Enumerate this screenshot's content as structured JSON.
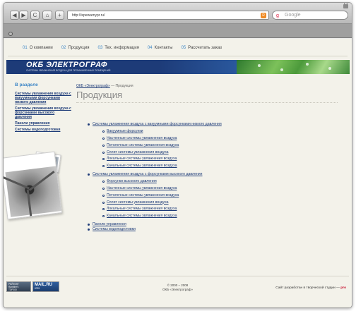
{
  "browser": {
    "url": "http://ixpewarnypr.ru/",
    "search_placeholder": "Google",
    "rss_label": "R",
    "search_glyph": "g",
    "buttons": {
      "back": "◀",
      "forward": "▶",
      "reload": "C",
      "home": "⌂",
      "add": "+"
    }
  },
  "topnav": [
    {
      "num": "01",
      "label": "О компании"
    },
    {
      "num": "02",
      "label": "Продукция"
    },
    {
      "num": "03",
      "label": "Тех. информация"
    },
    {
      "num": "04",
      "label": "Контакты"
    },
    {
      "num": "05",
      "label": "Рассчитать заказ"
    }
  ],
  "banner": {
    "logo": "ОКБ ЭЛЕКТРОГРАФ",
    "tagline": "СИСТЕМЫ УВЛАЖНЕНИЯ ВОЗДУХА ДЛЯ ПРОМЫШЛЕННЫХ ПОМЕЩЕНИЙ"
  },
  "sidebar": {
    "heading": "В разделе",
    "links": [
      "Системы увлажнения воздуха с вакуумными форсунками низкого давления",
      "Системы увлажнения воздуха с форсунками высокого давления",
      "Панели управления",
      "Системы водоподготовки"
    ]
  },
  "breadcrumb": {
    "home": "ОКБ «Электрограф»",
    "separator": " — ",
    "current": "Продукция"
  },
  "page_title": "Продукция",
  "products": [
    {
      "label": "Системы увлажнения воздуха с вакуумными форсунками низкого давления",
      "children": [
        "Вакуумные форсунки",
        "Настенные системы увлажнения воздуха",
        "Потолочные системы увлажнения воздуха",
        "Сплит системы увлажнения воздуха",
        "Локальные системы увлажнения воздуха",
        "Канальные системы увлажнения воздуха"
      ]
    },
    {
      "label": "Системы увлажнения воздуха с форсунками высокого давления",
      "children": [
        "Форсунки высокого давления",
        "Настенные системы увлажнения воздуха",
        "Потолочные системы увлажнения воздуха",
        "Сплит системы увлажнения воздуха",
        "Локальные системы увлажнения воздуха",
        "Канальные системы увлажнения воздуха"
      ]
    },
    {
      "label": "Панели управления",
      "children": []
    },
    {
      "label": "Системы водоподготовки",
      "children": []
    }
  ],
  "footer": {
    "copyright_years": "© 2000 – 2008",
    "copyright_owner": "ОКБ «Электрограф»",
    "studio_text": "Сайт разработан в творческой студии —",
    "studio_logo": "pro",
    "badge1": "РЕЙТИНГ\nRambler's\nTOP100",
    "badge2_top": "MAIL.RU",
    "badge2_bottom": "6755"
  },
  "colors": {
    "accent": "#3d86c6",
    "link": "#1d3b78",
    "banner": "#1d3b78",
    "page_bg": "#f3f2ea"
  }
}
